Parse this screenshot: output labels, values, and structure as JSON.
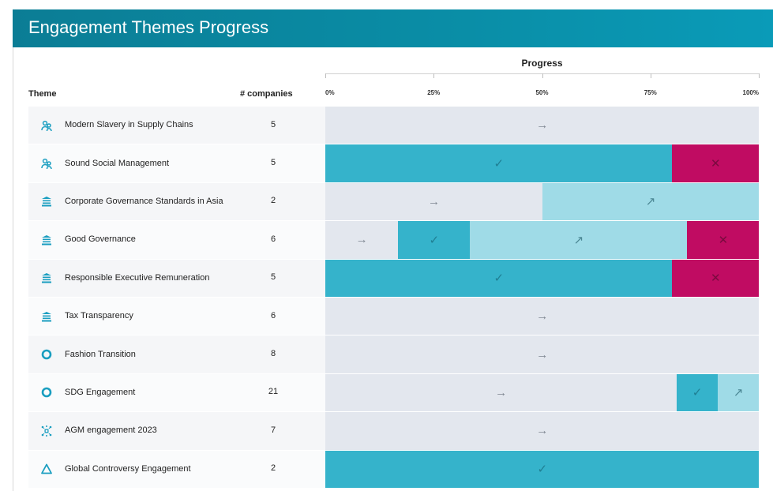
{
  "title": "Engagement Themes Progress",
  "columns": {
    "theme": "Theme",
    "companies": "# companies",
    "progress": "Progress"
  },
  "colors": {
    "banner": "#0a8ea7",
    "open": "#e3e7ee",
    "achieved": "#35b3cb",
    "in_progress": "#9fdbe7",
    "failed": "#c00c62",
    "icon": "#1a9ec0"
  },
  "chart_data": {
    "type": "bar",
    "orientation": "horizontal",
    "stacked": true,
    "xaxis": {
      "label": "Progress",
      "ticks": [
        "0%",
        "25%",
        "50%",
        "75%",
        "100%"
      ],
      "range": [
        0,
        100
      ]
    },
    "series_icons": {
      "open": "→",
      "achieved": "✓",
      "in_progress": "↗",
      "failed": "✕"
    },
    "rows": [
      {
        "theme": "Modern Slavery in Supply Chains",
        "companies": "5",
        "icon": "people-icon",
        "segments": [
          {
            "status": "open",
            "value": 100
          }
        ]
      },
      {
        "theme": "Sound Social Management",
        "companies": "5",
        "icon": "people-icon",
        "segments": [
          {
            "status": "achieved",
            "value": 80
          },
          {
            "status": "failed",
            "value": 20
          }
        ]
      },
      {
        "theme": "Corporate Governance Standards in Asia",
        "companies": "2",
        "icon": "institution-icon",
        "segments": [
          {
            "status": "open",
            "value": 50
          },
          {
            "status": "in_progress",
            "value": 50
          }
        ]
      },
      {
        "theme": "Good Governance",
        "companies": "6",
        "icon": "institution-icon",
        "segments": [
          {
            "status": "open",
            "value": 16.7
          },
          {
            "status": "achieved",
            "value": 16.7
          },
          {
            "status": "in_progress",
            "value": 50
          },
          {
            "status": "failed",
            "value": 16.7
          }
        ]
      },
      {
        "theme": "Responsible Executive Remuneration",
        "companies": "5",
        "icon": "institution-icon",
        "segments": [
          {
            "status": "achieved",
            "value": 80
          },
          {
            "status": "failed",
            "value": 20
          }
        ]
      },
      {
        "theme": "Tax Transparency",
        "companies": "6",
        "icon": "institution-icon",
        "segments": [
          {
            "status": "open",
            "value": 100
          }
        ]
      },
      {
        "theme": "Fashion Transition",
        "companies": "8",
        "icon": "ring-icon",
        "segments": [
          {
            "status": "open",
            "value": 100
          }
        ]
      },
      {
        "theme": "SDG Engagement",
        "companies": "21",
        "icon": "ring-icon",
        "segments": [
          {
            "status": "open",
            "value": 81
          },
          {
            "status": "achieved",
            "value": 9.5
          },
          {
            "status": "in_progress",
            "value": 9.5
          }
        ]
      },
      {
        "theme": "AGM engagement 2023",
        "companies": "7",
        "icon": "network-icon",
        "segments": [
          {
            "status": "open",
            "value": 100
          }
        ]
      },
      {
        "theme": "Global Controversy Engagement",
        "companies": "2",
        "icon": "triangle-icon",
        "segments": [
          {
            "status": "achieved",
            "value": 100
          }
        ]
      }
    ]
  }
}
